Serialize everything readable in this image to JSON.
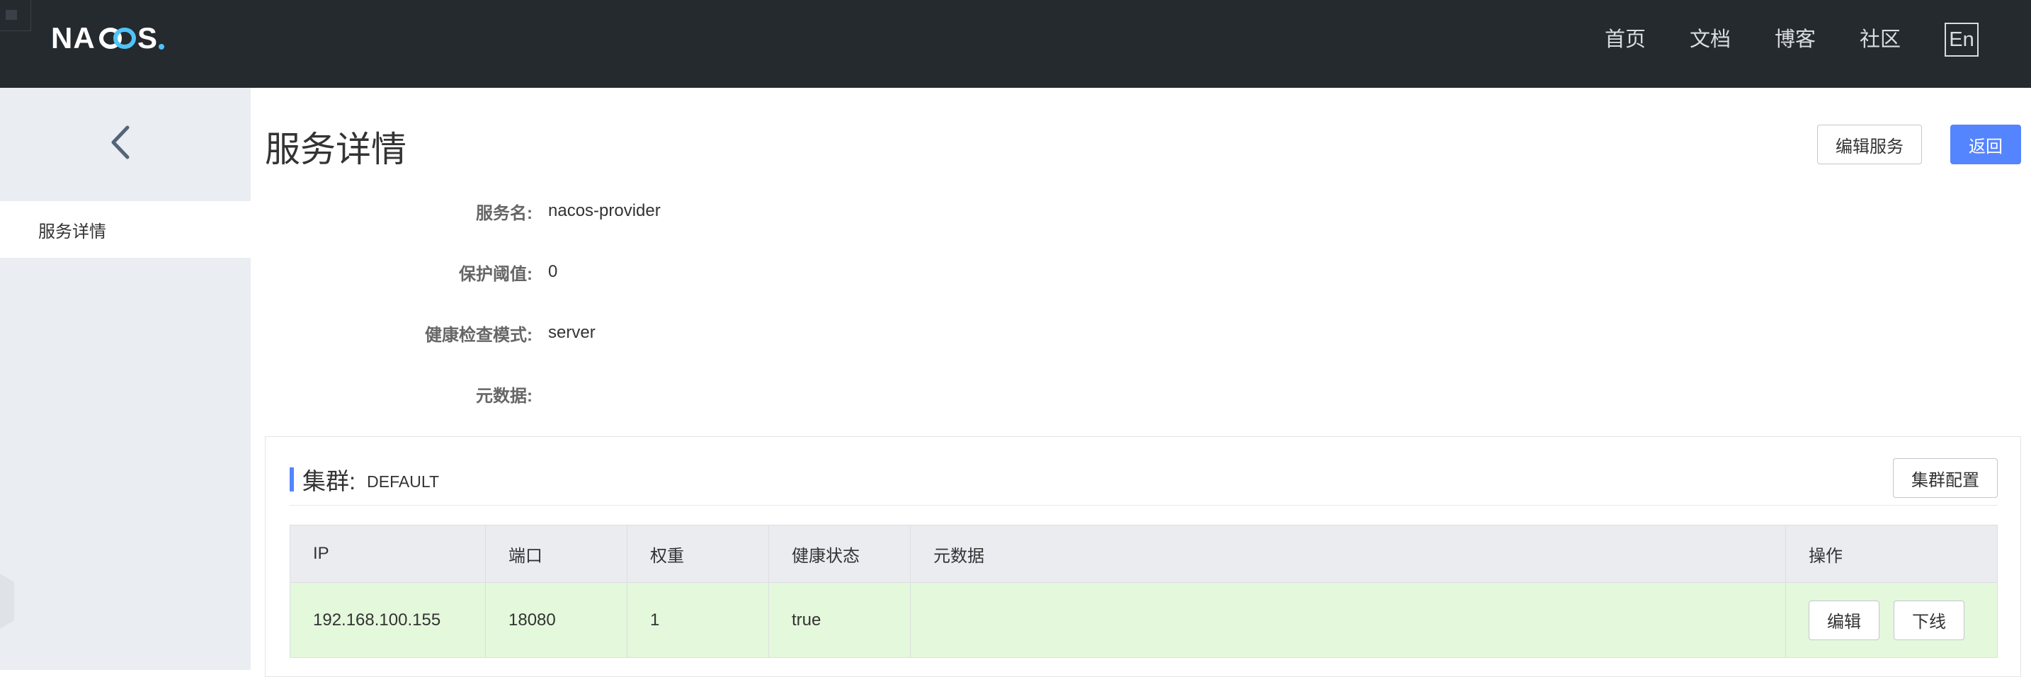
{
  "header": {
    "logo_text": "NACOS.",
    "nav": [
      "首页",
      "文档",
      "博客",
      "社区"
    ],
    "lang_button": "En"
  },
  "sidebar": {
    "back_icon": "chevron-left-icon",
    "items": [
      {
        "label": "服务详情"
      }
    ]
  },
  "main": {
    "title": "服务详情",
    "edit_service_label": "编辑服务",
    "back_label": "返回",
    "fields": [
      {
        "label": "服务名:",
        "value": "nacos-provider"
      },
      {
        "label": "保护阈值:",
        "value": "0"
      },
      {
        "label": "健康检查模式:",
        "value": "server"
      },
      {
        "label": "元数据:",
        "value": ""
      }
    ]
  },
  "cluster": {
    "title": "集群:",
    "name": "DEFAULT",
    "config_label": "集群配置",
    "table": {
      "headers": [
        "IP",
        "端口",
        "权重",
        "健康状态",
        "元数据",
        "操作"
      ],
      "rows": [
        {
          "ip": "192.168.100.155",
          "port": "18080",
          "weight": "1",
          "healthy": "true",
          "metadata": "",
          "actions": [
            "编辑",
            "下线"
          ]
        }
      ]
    }
  },
  "colors": {
    "topbar": "#252a2f",
    "sidebar": "#eaedf1",
    "primary": "#5584ff",
    "row_highlight": "#e4f8dc"
  }
}
